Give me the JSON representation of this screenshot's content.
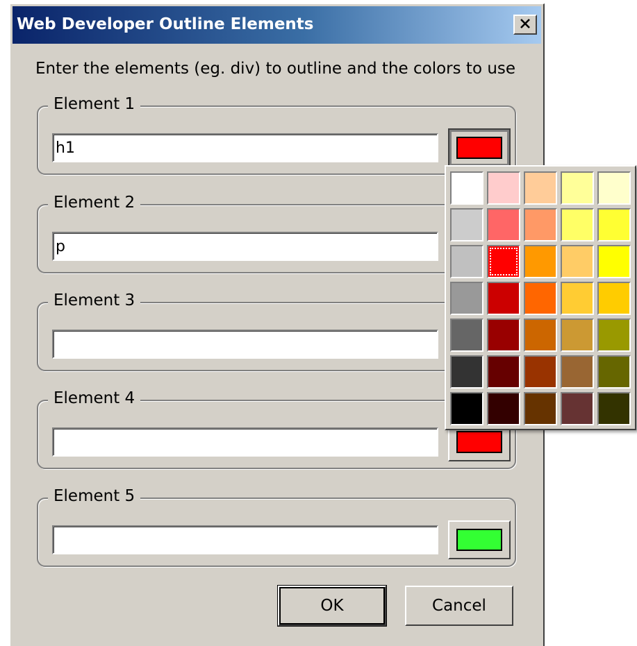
{
  "window": {
    "title": "Web Developer Outline Elements",
    "close_glyph": "✕",
    "close_icon": "close-icon"
  },
  "instruction": "Enter the elements (eg. div) to outline and the colors to use",
  "elements": [
    {
      "label": "Element 1",
      "value": "h1",
      "color": "#ff0000"
    },
    {
      "label": "Element 2",
      "value": "p",
      "color": "#ff0000"
    },
    {
      "label": "Element 3",
      "value": "",
      "color": "#ff0000"
    },
    {
      "label": "Element 4",
      "value": "",
      "color": "#ff0000"
    },
    {
      "label": "Element 5",
      "value": "",
      "color": "#33ff33"
    }
  ],
  "buttons": {
    "ok": "OK",
    "cancel": "Cancel"
  },
  "palette": {
    "selected_color": "#ff0000",
    "rows": [
      [
        "#ffffff",
        "#ffcccc",
        "#ffcc99",
        "#ffff99",
        "#ffffcc"
      ],
      [
        "#cccccc",
        "#ff6666",
        "#ff9966",
        "#ffff66",
        "#ffff33"
      ],
      [
        "#c0c0c0",
        "#ff0000",
        "#ff9900",
        "#ffcc66",
        "#ffff00"
      ],
      [
        "#999999",
        "#cc0000",
        "#ff6600",
        "#ffcc33",
        "#ffcc00"
      ],
      [
        "#666666",
        "#990000",
        "#cc6600",
        "#cc9933",
        "#999900"
      ],
      [
        "#333333",
        "#660000",
        "#993300",
        "#996633",
        "#666600"
      ],
      [
        "#000000",
        "#330000",
        "#663300",
        "#663333",
        "#333300"
      ]
    ]
  }
}
